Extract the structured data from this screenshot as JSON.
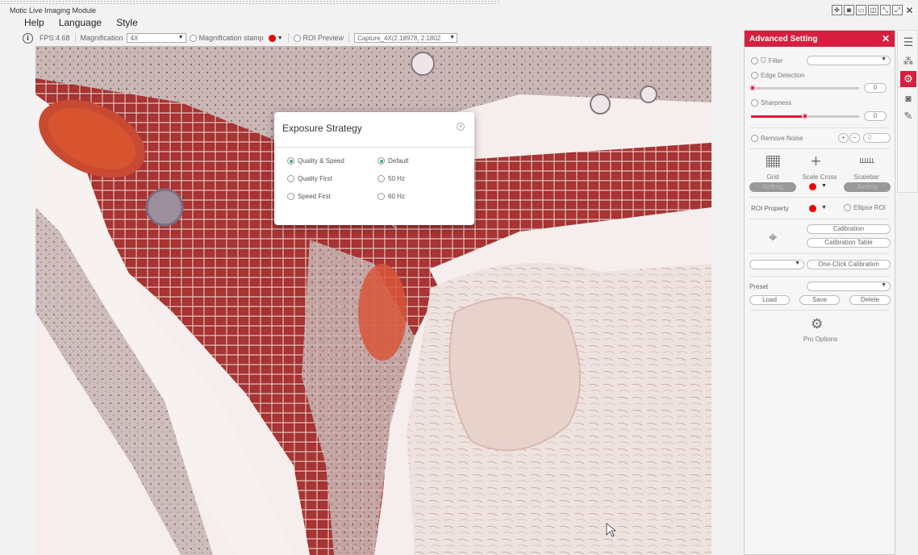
{
  "window": {
    "title": "Motic Live Imaging Module"
  },
  "menu": [
    "Help",
    "Language",
    "Style"
  ],
  "toolbar": {
    "fps": "FPS:4.68",
    "magnification_label": "Magnification",
    "magnification_value": "4X",
    "mag_stamp_label": "Magnification stamp",
    "roi_preview_label": "ROI Preview",
    "capture_value": "Capture_4X(2.18978, 2.1802",
    "stamp_color": "#e00000"
  },
  "dialog": {
    "title": "Exposure Strategy",
    "strategy_options": [
      {
        "label": "Quality & Speed",
        "selected": true
      },
      {
        "label": "Quality First",
        "selected": false
      },
      {
        "label": "Speed First",
        "selected": false
      }
    ],
    "frequency_options": [
      {
        "label": "Default",
        "selected": true
      },
      {
        "label": "50 Hz",
        "selected": false
      },
      {
        "label": "60 Hz",
        "selected": false
      }
    ]
  },
  "panel": {
    "title": "Advanced Setting",
    "accent": "#d81e3e",
    "filter_label": "Filter",
    "edge_label": "Edge Detection",
    "edge_value": "0",
    "sharpness_label": "Sharpness",
    "sharpness_value": "0",
    "noise_label": "Remove Noise",
    "noise_value": "0",
    "plus": "+",
    "minus": "−",
    "grid_label": "Grid",
    "scale_cross_label": "Scale Cross",
    "scalebar_label": "Scalebar",
    "setting_label": "Setting",
    "roi_property_label": "ROI Property",
    "ellipse_roi_label": "Ellipse ROI",
    "calibration_label": "Calibration",
    "calibration_table_label": "Calibration Table",
    "one_click_label": "One-Click Calibration",
    "preset_label": "Preset",
    "load_label": "Load",
    "save_label": "Save",
    "delete_label": "Delete",
    "pro_options_label": "Pro Options"
  },
  "sidebar_icons": [
    "sliders-icon",
    "color-balls-icon",
    "gears-icon",
    "camera-icon",
    "ruler-icon"
  ]
}
